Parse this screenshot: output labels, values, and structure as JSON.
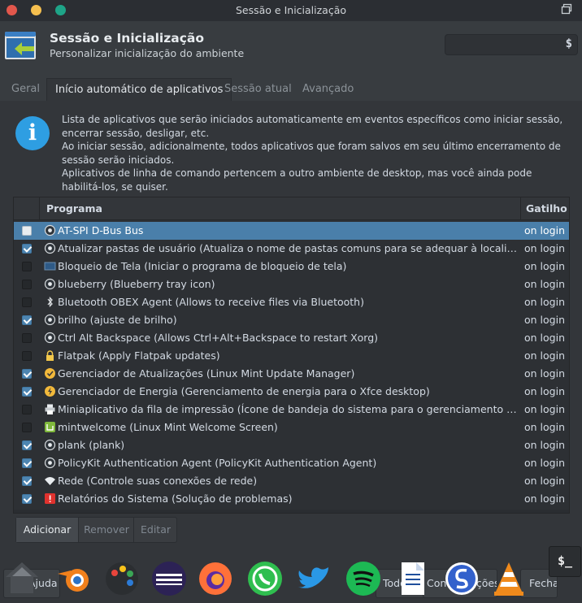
{
  "window": {
    "title": "Sessão e Inicialização"
  },
  "header": {
    "title": "Sessão e Inicialização",
    "subtitle": "Personalizar inicialização do ambiente",
    "search_placeholder": ""
  },
  "tabs": [
    {
      "label": "Geral"
    },
    {
      "label": "Início automático de aplicativos"
    },
    {
      "label": "Sessão atual"
    },
    {
      "label": "Avançado"
    }
  ],
  "info": {
    "line1": "Lista de aplicativos que serão iniciados automaticamente em eventos específicos como iniciar sessão, encerrar sessão, desligar, etc.",
    "line2": "Ao iniciar sessão, adicionalmente, todos aplicativos que foram salvos em seu último encerramento de sessão serão iniciados.",
    "line3": "Aplicativos de linha de comando pertencem a outro ambiente de desktop, mas você ainda pode habilitá-los, se quiser."
  },
  "table": {
    "col_program": "Programa",
    "col_trigger": "Gatilho",
    "rows": [
      {
        "name": "AT-SPI D-Bus Bus",
        "trigger": "on login",
        "checked": false,
        "selected": true,
        "icon": "gear-icon"
      },
      {
        "name": "Atualizar pastas de usuário (Atualiza o nome de pastas comuns para se adequar à localização atual)",
        "trigger": "on login",
        "checked": true,
        "selected": false,
        "icon": "gear-icon"
      },
      {
        "name": "Bloqueio de Tela (Iniciar o programa de bloqueio de tela)",
        "trigger": "on login",
        "checked": false,
        "selected": false,
        "icon": "screen-icon"
      },
      {
        "name": "blueberry (Blueberry tray icon)",
        "trigger": "on login",
        "checked": false,
        "selected": false,
        "icon": "gear-icon"
      },
      {
        "name": "Bluetooth OBEX Agent (Allows to receive files via Bluetooth)",
        "trigger": "on login",
        "checked": false,
        "selected": false,
        "icon": "bluetooth-icon"
      },
      {
        "name": "brilho (ajuste de brilho)",
        "trigger": "on login",
        "checked": true,
        "selected": false,
        "icon": "gear-icon"
      },
      {
        "name": "Ctrl Alt Backspace (Allows Ctrl+Alt+Backspace to restart Xorg)",
        "trigger": "on login",
        "checked": false,
        "selected": false,
        "icon": "gear-icon"
      },
      {
        "name": "Flatpak (Apply Flatpak updates)",
        "trigger": "on login",
        "checked": false,
        "selected": false,
        "icon": "lock-icon"
      },
      {
        "name": "Gerenciador de Atualizações (Linux Mint Update Manager)",
        "trigger": "on login",
        "checked": true,
        "selected": false,
        "icon": "update-shield-icon"
      },
      {
        "name": "Gerenciador de Energia (Gerenciamento de energia para o Xfce desktop)",
        "trigger": "on login",
        "checked": true,
        "selected": false,
        "icon": "power-icon"
      },
      {
        "name": "Miniaplicativo da fila de impressão (Ícone de bandeja do sistema para o gerenciamento de trabalhos de impressão)",
        "trigger": "on login",
        "checked": false,
        "selected": false,
        "icon": "printer-icon"
      },
      {
        "name": "mintwelcome (Linux Mint Welcome Screen)",
        "trigger": "on login",
        "checked": false,
        "selected": false,
        "icon": "mint-icon"
      },
      {
        "name": "plank (plank)",
        "trigger": "on login",
        "checked": true,
        "selected": false,
        "icon": "gear-icon"
      },
      {
        "name": "PolicyKit Authentication Agent (PolicyKit Authentication Agent)",
        "trigger": "on login",
        "checked": true,
        "selected": false,
        "icon": "gear-icon"
      },
      {
        "name": "Rede (Controle suas conexões de rede)",
        "trigger": "on login",
        "checked": true,
        "selected": false,
        "icon": "wifi-icon"
      },
      {
        "name": "Relatórios do Sistema (Solução de problemas)",
        "trigger": "on login",
        "checked": true,
        "selected": false,
        "icon": "warning-icon"
      }
    ]
  },
  "buttons": {
    "add": "Adicionar",
    "remove": "Remover",
    "edit": "Editar"
  },
  "footer": {
    "help": "Ajuda",
    "all_label": "Todos",
    "settings": "Configurações",
    "close": "Fechar"
  },
  "dock": [
    {
      "icon": "home-icon"
    },
    {
      "icon": "blender-icon"
    },
    {
      "icon": "palette-icon"
    },
    {
      "icon": "eclipse-icon"
    },
    {
      "icon": "firefox-icon"
    },
    {
      "icon": "whatsapp-icon"
    },
    {
      "icon": "twitter-icon"
    },
    {
      "icon": "spotify-icon"
    },
    {
      "icon": "document-icon"
    },
    {
      "icon": "simplenote-icon"
    },
    {
      "icon": "vlc-icon"
    }
  ],
  "terminal_label": "$_",
  "colors": {
    "selection": "#4a7faa",
    "accent": "#2e9ee2",
    "checked": "#4d85b1"
  }
}
